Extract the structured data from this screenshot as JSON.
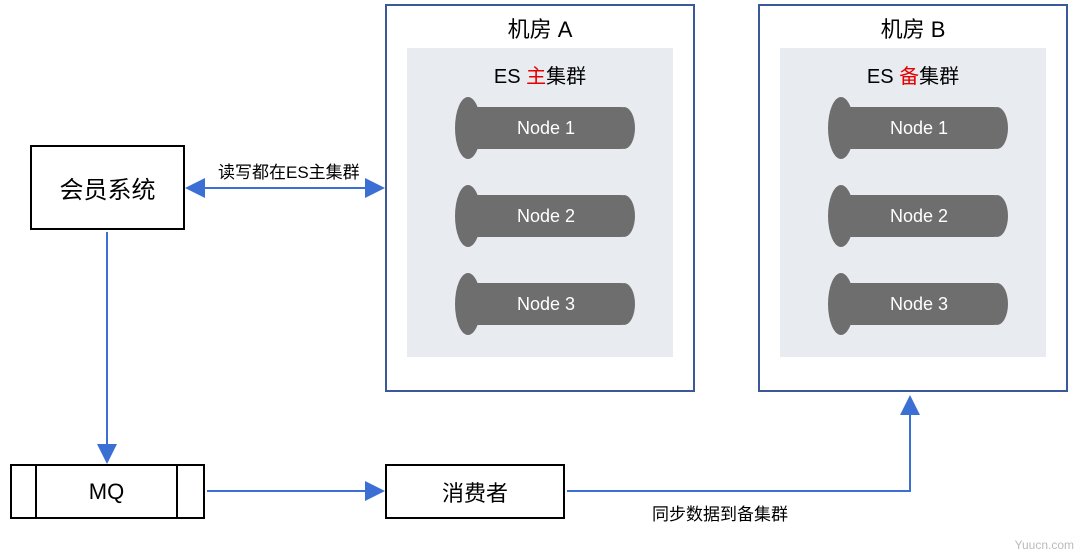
{
  "member_system": "会员系统",
  "mq": "MQ",
  "consumer": "消费者",
  "room_a_title": "机房 A",
  "room_b_title": "机房 B",
  "cluster_a": {
    "prefix": "ES ",
    "accent": "主",
    "suffix": "集群",
    "nodes": [
      "Node 1",
      "Node 2",
      "Node 3"
    ]
  },
  "cluster_b": {
    "prefix": "ES ",
    "accent": "备",
    "suffix": "集群",
    "nodes": [
      "Node 1",
      "Node 2",
      "Node 3"
    ]
  },
  "label_rw": "读写都在ES主集群",
  "label_sync": "同步数据到备集群",
  "watermark": "Yuucn.com",
  "colors": {
    "arrow": "#3b6fd4",
    "room_border": "#3b5998",
    "node_fill": "#6e6e6e",
    "accent": "#e60000"
  }
}
